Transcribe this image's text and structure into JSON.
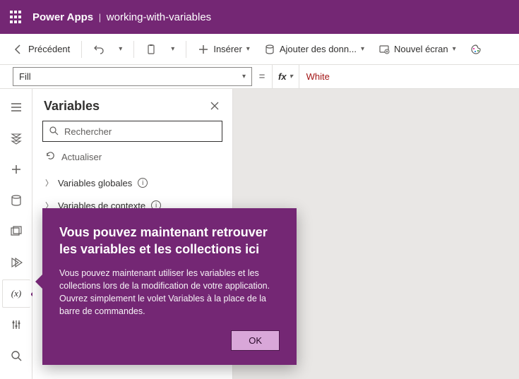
{
  "header": {
    "app": "Power Apps",
    "separator": "|",
    "file": "working-with-variables"
  },
  "cmdbar": {
    "back": "Précédent",
    "insert": "Insérer",
    "add_data": "Ajouter des donn...",
    "new_screen": "Nouvel écran"
  },
  "formula": {
    "property": "Fill",
    "eq": "=",
    "fx": "fx",
    "value": "White"
  },
  "panel": {
    "title": "Variables",
    "search_placeholder": "Rechercher",
    "refresh": "Actualiser",
    "rows": [
      {
        "label": "Variables globales"
      },
      {
        "label": "Variables de contexte"
      }
    ]
  },
  "callout": {
    "title": "Vous pouvez maintenant retrouver les variables et les collections ici",
    "body": "Vous pouvez maintenant utiliser les variables et les collections lors de la modification de votre application. Ouvrez simplement le volet Variables à la place de la barre de commandes.",
    "ok": "OK"
  }
}
